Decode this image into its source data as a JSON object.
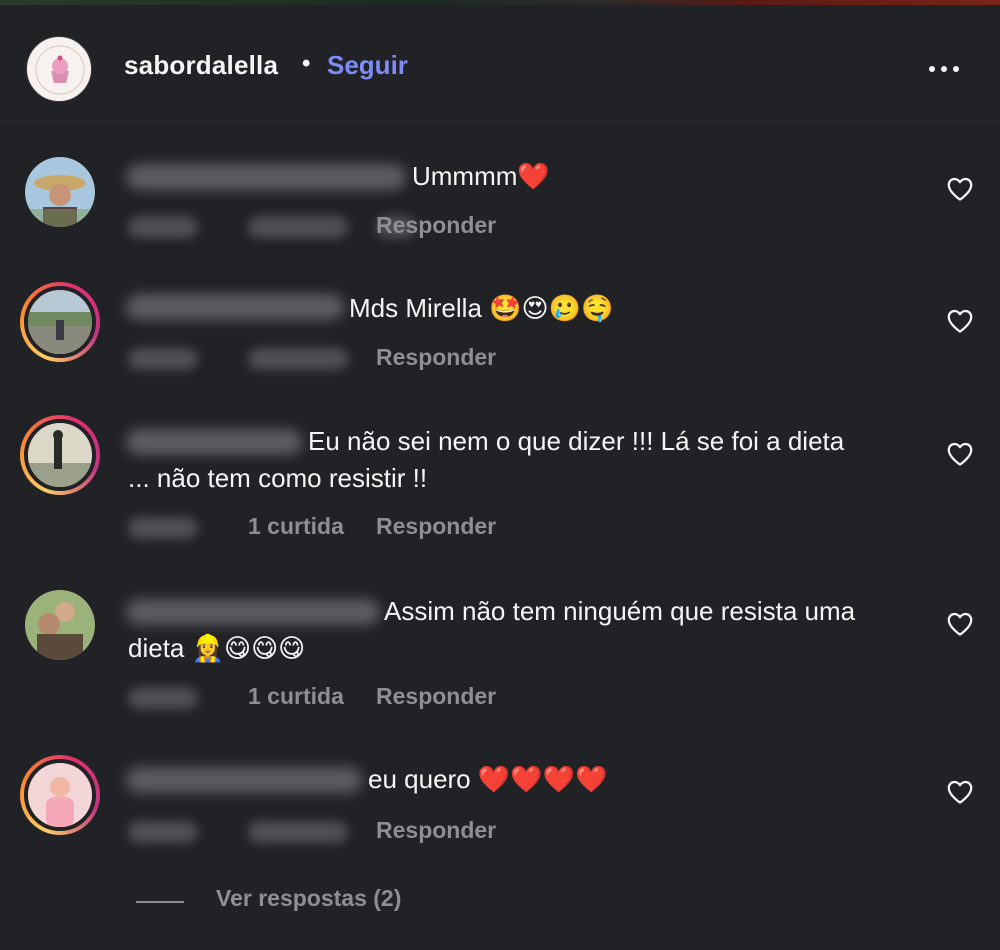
{
  "post_header": {
    "username": "sabordalella",
    "separator": "•",
    "follow_label": "Seguir",
    "more_icon": "more-horizontal-icon"
  },
  "comments": [
    {
      "text": "Ummmm❤️",
      "likes_label": "",
      "reply_label": "Responder",
      "like_icon": "heart-outline-icon"
    },
    {
      "text": "Mds Mirella 🤩😍🥲🤤",
      "likes_label": "",
      "reply_label": "Responder",
      "like_icon": "heart-outline-icon"
    },
    {
      "text": "Eu não sei nem o que dizer !!! Lá se foi a dieta\n... não tem como resistir !!",
      "likes_label": "1 curtida",
      "reply_label": "Responder",
      "like_icon": "heart-outline-icon"
    },
    {
      "text": "Assim não tem ninguém que resista uma\ndieta 👷‍♀️😋😋😋",
      "likes_label": "1 curtida",
      "reply_label": "Responder",
      "like_icon": "heart-outline-icon"
    },
    {
      "text": "eu quero ❤️❤️❤️❤️",
      "likes_label": "",
      "reply_label": "Responder",
      "like_icon": "heart-outline-icon"
    }
  ],
  "view_replies": {
    "label": "Ver respostas (2)"
  },
  "colors": {
    "background": "#212226",
    "link": "#7d8cf7",
    "secondary_text": "#8e8e93"
  }
}
